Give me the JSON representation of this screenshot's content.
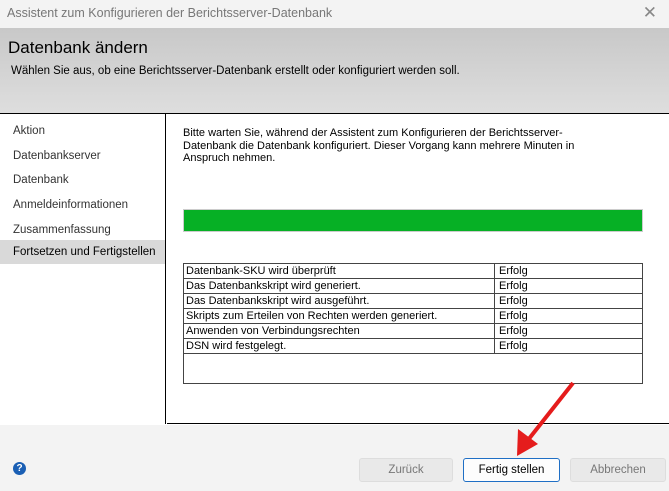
{
  "window": {
    "title": "Assistent zum Konfigurieren der Berichtsserver-Datenbank"
  },
  "header": {
    "title": "Datenbank ändern",
    "subtitle": "Wählen Sie aus, ob eine Berichtsserver-Datenbank erstellt oder konfiguriert werden soll."
  },
  "sidebar": {
    "items": [
      {
        "label": "Aktion"
      },
      {
        "label": "Datenbankserver"
      },
      {
        "label": "Datenbank"
      },
      {
        "label": "Anmeldeinformationen"
      },
      {
        "label": "Zusammenfassung"
      },
      {
        "label": "Fortsetzen und Fertigstellen",
        "selected": true
      }
    ]
  },
  "main": {
    "intro": "Bitte warten Sie, während der Assistent zum Konfigurieren der Berichtsserver-Datenbank die Datenbank konfiguriert. Dieser Vorgang kann mehrere Minuten in Anspruch nehmen.",
    "progress_percent": 100,
    "steps": [
      {
        "step": "Datenbank-SKU wird überprüft",
        "status": "Erfolg"
      },
      {
        "step": "Das Datenbankskript wird generiert.",
        "status": "Erfolg"
      },
      {
        "step": "Das Datenbankskript wird ausgeführt.",
        "status": "Erfolg"
      },
      {
        "step": "Skripts zum Erteilen von Rechten werden generiert.",
        "status": "Erfolg"
      },
      {
        "step": "Anwenden von Verbindungsrechten",
        "status": "Erfolg"
      },
      {
        "step": "DSN wird festgelegt.",
        "status": "Erfolg"
      }
    ]
  },
  "footer": {
    "back": "Zurück",
    "finish": "Fertig stellen",
    "cancel": "Abbrechen"
  },
  "colors": {
    "progress": "#06b025",
    "arrow": "#e51c1c"
  }
}
